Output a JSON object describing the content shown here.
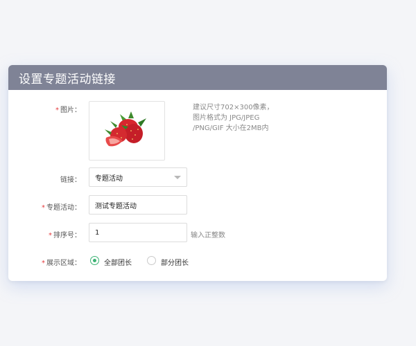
{
  "dialog": {
    "title": "设置专题活动链接"
  },
  "form": {
    "image": {
      "label": "图片：",
      "hint_lines": [
        "建议尺寸702×300像素，",
        "图片格式为 JPG/JPEG",
        "/PNG/GIF 大小在2MB内"
      ]
    },
    "link": {
      "label": "链接：",
      "selected": "专题活动"
    },
    "topic": {
      "label": "专题活动：",
      "value": "测试专题活动"
    },
    "sort": {
      "label": "排序号：",
      "value": "1",
      "hint": "输入正整数"
    },
    "display_area": {
      "label": "展示区域：",
      "options": [
        {
          "label": "全部团长",
          "checked": true
        },
        {
          "label": "部分团长",
          "checked": false
        }
      ]
    }
  },
  "colors": {
    "header_bg": "#7f8396",
    "required": "#e4393c",
    "radio_active": "#3bb273"
  },
  "icons": {
    "image_thumb": "strawberry-image",
    "select_caret": "caret-down-icon"
  }
}
